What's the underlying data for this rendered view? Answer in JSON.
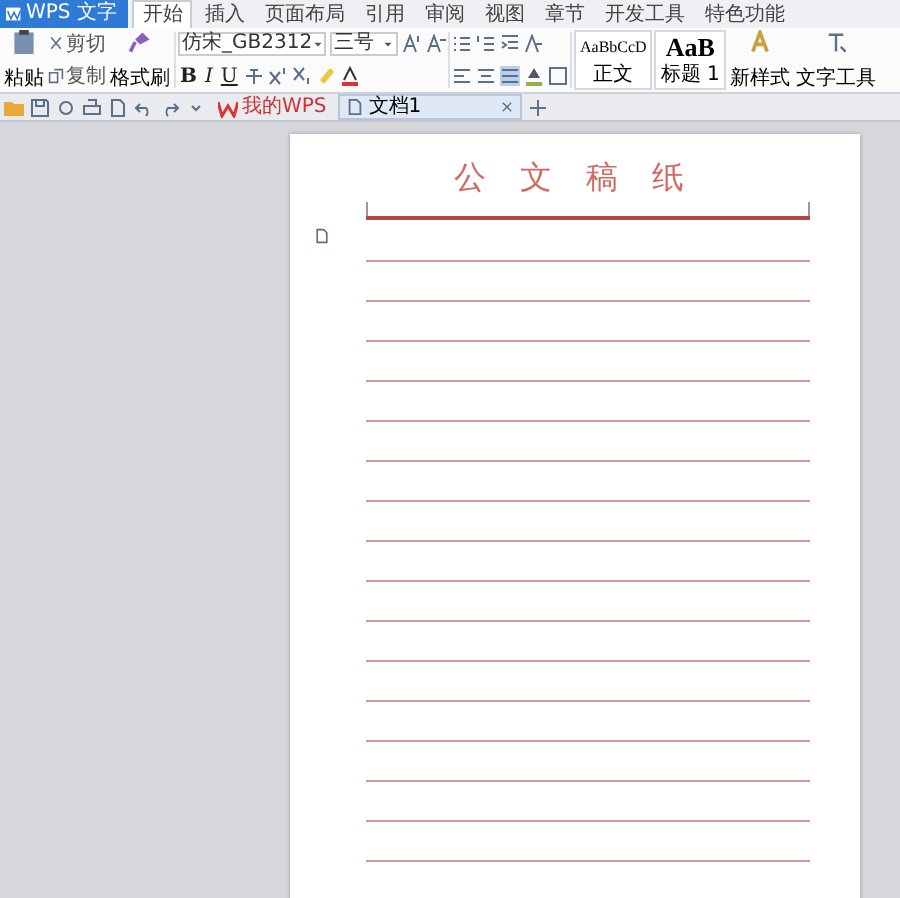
{
  "app_button": {
    "label": "WPS 文字"
  },
  "menu_tabs": [
    {
      "label": "开始",
      "selected": true
    },
    {
      "label": "插入",
      "selected": false
    },
    {
      "label": "页面布局",
      "selected": false
    },
    {
      "label": "引用",
      "selected": false
    },
    {
      "label": "审阅",
      "selected": false
    },
    {
      "label": "视图",
      "selected": false
    },
    {
      "label": "章节",
      "selected": false
    },
    {
      "label": "开发工具",
      "selected": false
    },
    {
      "label": "特色功能",
      "selected": false
    }
  ],
  "clipboard": {
    "paste": "粘贴",
    "cut": "剪切",
    "copy": "复制",
    "format_painter": "格式刷"
  },
  "font": {
    "family": "仿宋_GB2312",
    "size": "三号",
    "format_buttons": [
      "B",
      "I",
      "U"
    ]
  },
  "styles": [
    {
      "sample": "AaBbCcD",
      "name": "正文",
      "kind": "normal"
    },
    {
      "sample": "AaB",
      "name": "标题 1",
      "kind": "heading"
    }
  ],
  "new_style": "新样式",
  "text_tools": "文字工具",
  "doc_tabs": [
    {
      "label": "我的WPS",
      "selected": false,
      "kind": "home"
    },
    {
      "label": "文档1",
      "selected": true,
      "kind": "document"
    }
  ],
  "document": {
    "title": "公 文 稿 纸"
  }
}
